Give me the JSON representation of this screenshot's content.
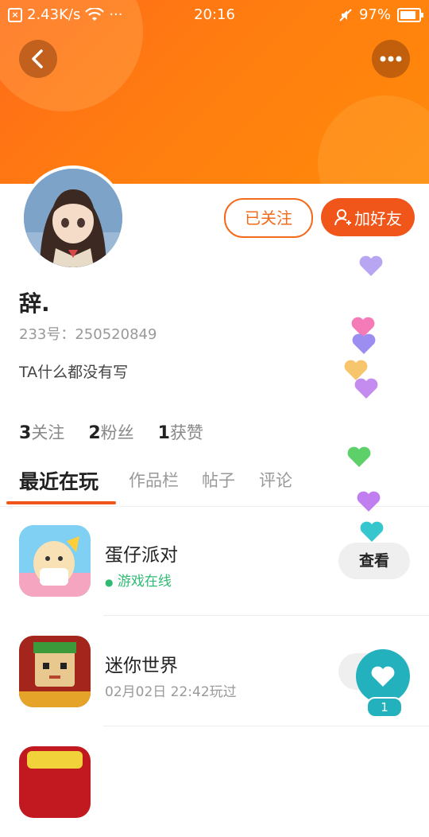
{
  "status_bar": {
    "speed": "2.43K/s",
    "dots": "···",
    "time": "20:16",
    "battery": "97%",
    "icons": [
      "notification-x-icon",
      "wifi-icon",
      "mute-icon",
      "battery-icon"
    ]
  },
  "header": {
    "back_icon": "chevron-left-icon",
    "more_icon": "more-dots-icon"
  },
  "profile": {
    "follow_label": "已关注",
    "add_friend_label": "加好友",
    "name": "辞.",
    "id_label": "233号：",
    "id_value": "250520849",
    "bio": "TA什么都没有写",
    "stats": {
      "following_count": "3",
      "following_label": "关注",
      "fans_count": "2",
      "fans_label": "粉丝",
      "likes_count": "1",
      "likes_label": "获赞"
    }
  },
  "tabs": [
    "最近在玩",
    "作品栏",
    "帖子",
    "评论"
  ],
  "games": [
    {
      "title": "蛋仔派对",
      "sub": "游戏在线",
      "action": "查看"
    },
    {
      "title": "迷你世界",
      "sub": "02月02日 22:42玩过",
      "action": ""
    },
    {
      "title": "",
      "sub": "",
      "action": ""
    }
  ],
  "like_fab": {
    "count": "1"
  },
  "colors": {
    "accent": "#f0551a",
    "header": "#ff7a12",
    "online": "#2fba73",
    "like": "#23b2bd"
  }
}
